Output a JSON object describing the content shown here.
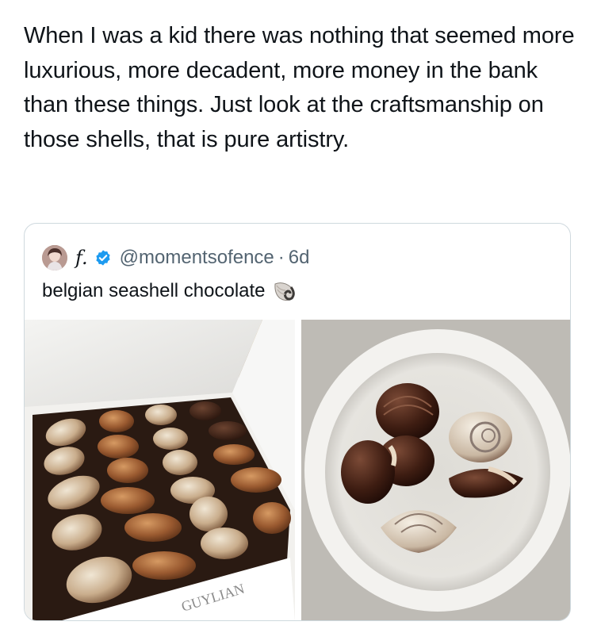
{
  "post": {
    "text": "When I was a kid there was nothing that seemed more luxurious, more decadent, more money in the bank than these things. Just look at the craftsmanship on those shells, that is pure artistry."
  },
  "quote": {
    "display_name": "f.",
    "handle": "@momentsofence",
    "separator": "·",
    "time": "6d",
    "text": "belgian seashell chocolate",
    "emoji_icon": "spiral-shell-icon",
    "verified_icon": "verified-badge-icon",
    "colors": {
      "verified": "#1d9bf0",
      "secondary_text": "#536471",
      "border": "#cfd9de"
    },
    "media": [
      {
        "name": "chocolate-box-photo",
        "brand_text": "GUYLIAN"
      },
      {
        "name": "chocolate-bowl-photo"
      }
    ]
  }
}
